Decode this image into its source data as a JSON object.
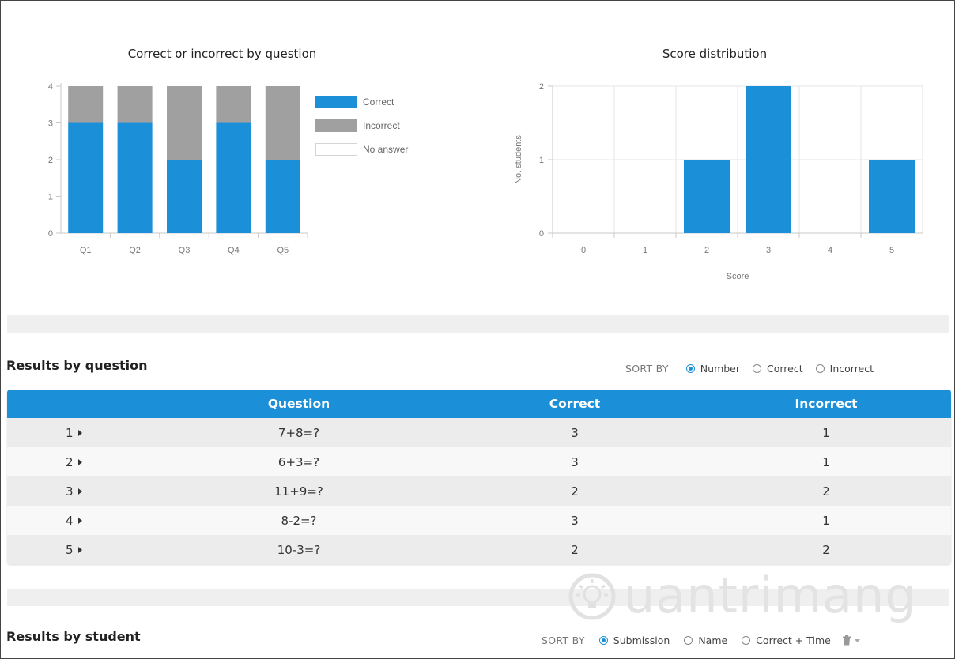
{
  "colors": {
    "accent": "#1b8fd8",
    "correct": "#1b8fd8",
    "incorrect": "#a0a0a0"
  },
  "chart_data": [
    {
      "type": "bar",
      "stacked": true,
      "title": "Correct or incorrect by question",
      "categories": [
        "Q1",
        "Q2",
        "Q3",
        "Q4",
        "Q5"
      ],
      "series": [
        {
          "name": "Correct",
          "values": [
            3,
            3,
            2,
            3,
            2
          ],
          "color": "#1b8fd8"
        },
        {
          "name": "Incorrect",
          "values": [
            1,
            1,
            2,
            1,
            2
          ],
          "color": "#a0a0a0"
        },
        {
          "name": "No answer",
          "values": [
            0,
            0,
            0,
            0,
            0
          ],
          "color": "#ffffff"
        }
      ],
      "y_ticks": [
        "0",
        "1",
        "2",
        "3",
        "4"
      ],
      "ylim": [
        0,
        4
      ],
      "legend_position": "right",
      "grid": false
    },
    {
      "type": "bar",
      "title": "Score distribution",
      "categories": [
        "0",
        "1",
        "2",
        "3",
        "4",
        "5"
      ],
      "values": [
        0,
        0,
        1,
        2,
        0,
        1
      ],
      "y_ticks": [
        "0",
        "1",
        "2"
      ],
      "ylim": [
        0,
        2
      ],
      "xlabel": "Score",
      "ylabel": "No. students",
      "grid": true
    }
  ],
  "results_by_question": {
    "title": "Results by question",
    "sort_label": "SORT BY",
    "sort_options": [
      "Number",
      "Correct",
      "Incorrect"
    ],
    "selected_sort": "Number",
    "columns": [
      "Question",
      "Correct",
      "Incorrect"
    ],
    "rows": [
      {
        "num": "1",
        "question": "7+8=?",
        "correct": "3",
        "incorrect": "1"
      },
      {
        "num": "2",
        "question": "6+3=?",
        "correct": "3",
        "incorrect": "1"
      },
      {
        "num": "3",
        "question": "11+9=?",
        "correct": "2",
        "incorrect": "2"
      },
      {
        "num": "4",
        "question": "8-2=?",
        "correct": "3",
        "incorrect": "1"
      },
      {
        "num": "5",
        "question": "10-3=?",
        "correct": "2",
        "incorrect": "2"
      }
    ]
  },
  "results_by_student": {
    "title": "Results by student",
    "sort_label": "SORT BY",
    "sort_options": [
      "Submission",
      "Name",
      "Correct + Time"
    ],
    "selected_sort": "Submission"
  },
  "watermark": {
    "text": "uantrimang"
  }
}
